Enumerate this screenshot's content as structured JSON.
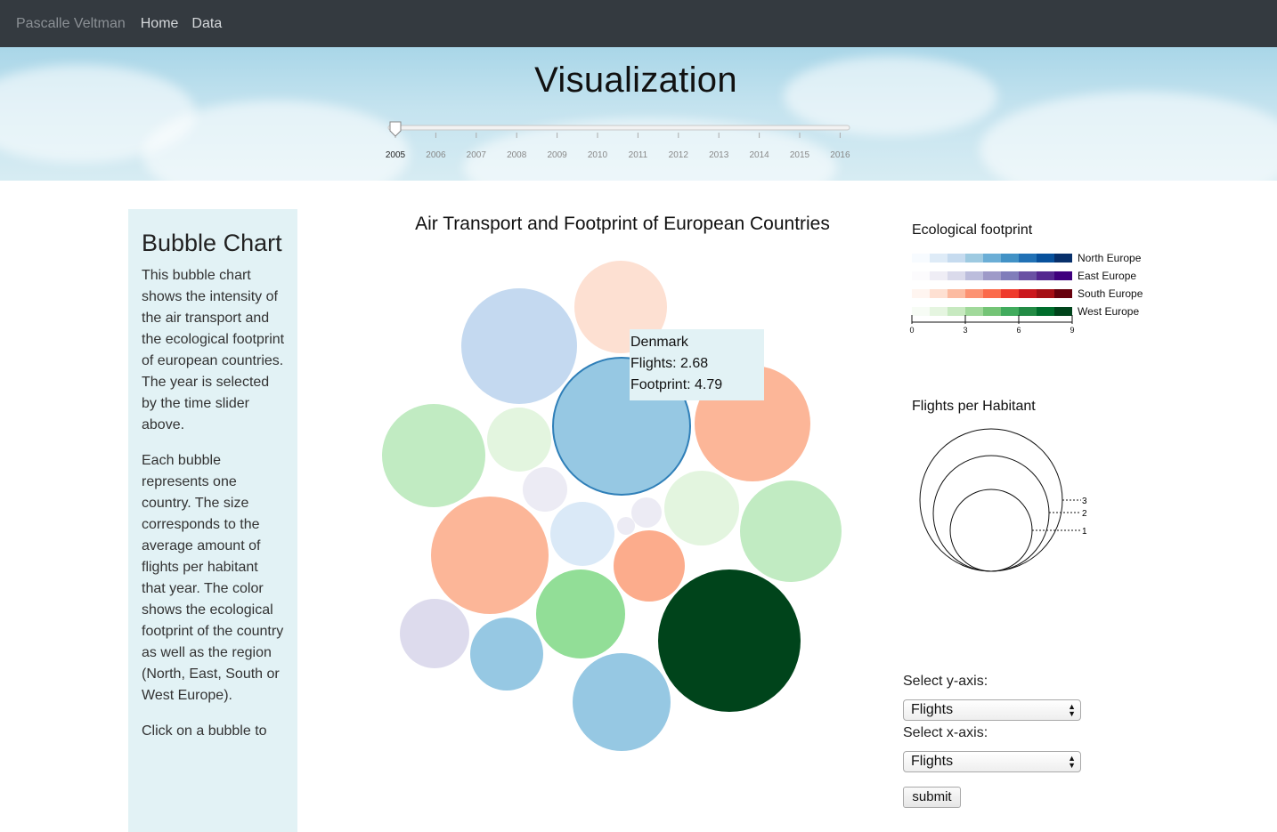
{
  "navbar": {
    "brand": "Pascalle Veltman",
    "links": [
      "Home",
      "Data"
    ]
  },
  "hero": {
    "title": "Visualization",
    "slider": {
      "years": [
        "2005",
        "2006",
        "2007",
        "2008",
        "2009",
        "2010",
        "2011",
        "2012",
        "2013",
        "2014",
        "2015",
        "2016"
      ],
      "selected": "2005"
    }
  },
  "info": {
    "heading": "Bubble Chart",
    "paragraphs": [
      "This bubble chart shows the intensity of the air transport and the ecological footprint of european countries. The year is selected by the time slider above.",
      "Each bubble represents one country. The size corresponds to the average amount of flights per habitant that year. The color shows the ecological footprint of the country as well as the region (North, East, South or West Europe).",
      "Click on a bubble to"
    ]
  },
  "chart": {
    "title": "Air Transport and Footprint of European Countries"
  },
  "tooltip": {
    "country": "Denmark",
    "flights": "Flights: 2.68",
    "footprint": "Footprint: 4.79"
  },
  "eco_legend": {
    "title": "Ecological footprint",
    "regions": [
      {
        "name": "North Europe",
        "colors": [
          "#f7fbff",
          "#deebf7",
          "#c6dbef",
          "#9ecae1",
          "#6baed6",
          "#4292c6",
          "#2171b5",
          "#08519c",
          "#08306b"
        ]
      },
      {
        "name": "East Europe",
        "colors": [
          "#fcfbfd",
          "#efedf5",
          "#dadaeb",
          "#bcbddc",
          "#9e9ac8",
          "#807dba",
          "#6a51a3",
          "#54278f",
          "#3f007d"
        ]
      },
      {
        "name": "South Europe",
        "colors": [
          "#fff5f0",
          "#fee0d2",
          "#fcbba1",
          "#fc9272",
          "#fb6a4a",
          "#ef3b2c",
          "#cb181d",
          "#a50f15",
          "#67000d"
        ]
      },
      {
        "name": "West Europe",
        "colors": [
          "#f7fcf5",
          "#e5f5e0",
          "#c7e9c0",
          "#a1d99b",
          "#74c476",
          "#41ab5d",
          "#238b45",
          "#006d2c",
          "#00441b"
        ]
      }
    ],
    "ticks": [
      "0",
      "3",
      "6",
      "9"
    ]
  },
  "size_legend": {
    "title": "Flights per Habitant",
    "values": [
      "3",
      "2",
      "1"
    ]
  },
  "controls": {
    "y_label": "Select y-axis:",
    "y_value": "Flights",
    "x_label": "Select x-axis:",
    "x_value": "Flights",
    "submit": "submit"
  },
  "chart_data": {
    "type": "bubble",
    "title": "Air Transport and Footprint of European Countries",
    "bubbles": [
      {
        "region": "North Europe",
        "color": "#c4d9f0"
      },
      {
        "region": "South Europe",
        "color": "#fde0d2"
      },
      {
        "region": "North Europe",
        "label": "Denmark",
        "flights": 2.68,
        "footprint": 4.79,
        "color": "#96c8e3",
        "highlighted": true
      },
      {
        "region": "South Europe",
        "color": "#fcb698"
      },
      {
        "region": "West Europe",
        "color": "#c1ebc2"
      },
      {
        "region": "West Europe",
        "color": "#e3f5df"
      },
      {
        "region": "East Europe",
        "color": "#ecebf4"
      },
      {
        "region": "South Europe",
        "color": "#fcb698"
      },
      {
        "region": "North Europe",
        "color": "#dae9f7"
      },
      {
        "region": "East Europe",
        "color": "#ecebf4"
      },
      {
        "region": "East Europe",
        "color": "#ecebf4"
      },
      {
        "region": "West Europe",
        "color": "#e3f5df"
      },
      {
        "region": "West Europe",
        "color": "#c1ebc2"
      },
      {
        "region": "South Europe",
        "color": "#fcac8c"
      },
      {
        "region": "West Europe",
        "color": "#92de97"
      },
      {
        "region": "East Europe",
        "color": "#dddbed"
      },
      {
        "region": "North Europe",
        "color": "#96c8e3"
      },
      {
        "region": "North Europe",
        "color": "#96c8e3"
      },
      {
        "region": "West Europe",
        "color": "#00441b"
      }
    ]
  }
}
